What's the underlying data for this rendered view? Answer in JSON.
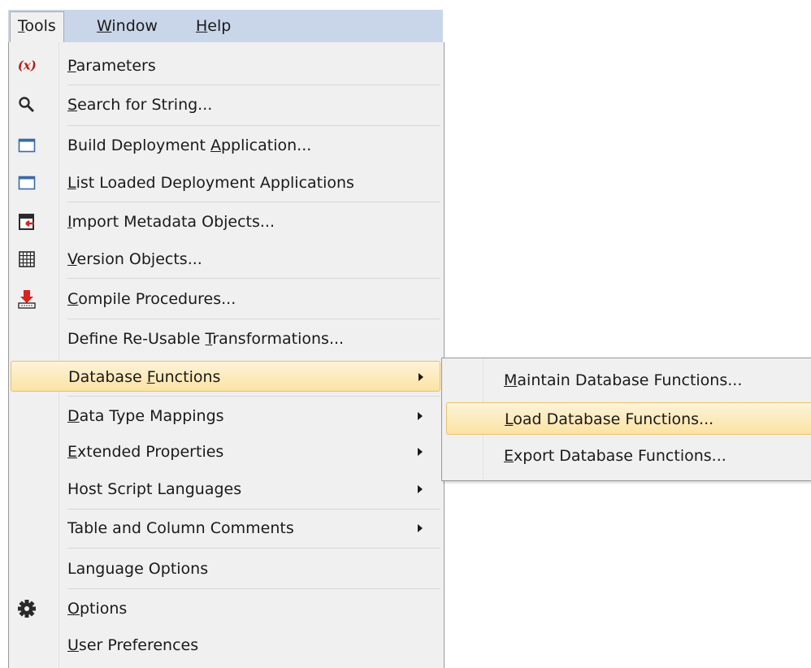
{
  "menubar": {
    "tools": "Tools",
    "window": "Window",
    "help": "Help"
  },
  "menu": {
    "items": [
      {
        "label": "Parameters",
        "icon": "parameters-x-icon"
      },
      {
        "label": "Search for String...",
        "icon": "magnifier-icon"
      },
      {
        "label": "Build Deployment Application...",
        "icon": "window-icon"
      },
      {
        "label": "List Loaded Deployment Applications",
        "icon": "window-icon"
      },
      {
        "label": "Import Metadata Objects...",
        "icon": "import-icon"
      },
      {
        "label": "Version Objects...",
        "icon": "grid-icon"
      },
      {
        "label": "Compile Procedures...",
        "icon": "compile-download-icon"
      },
      {
        "label": "Define Re-Usable Transformations...",
        "icon": ""
      },
      {
        "label": "Database Functions",
        "icon": ""
      },
      {
        "label": "Data Type Mappings",
        "icon": ""
      },
      {
        "label": "Extended Properties",
        "icon": ""
      },
      {
        "label": "Host Script Languages",
        "icon": ""
      },
      {
        "label": "Table and Column Comments",
        "icon": ""
      },
      {
        "label": "Language Options",
        "icon": ""
      },
      {
        "label": "Options",
        "icon": "gear-icon"
      },
      {
        "label": "User Preferences",
        "icon": ""
      }
    ]
  },
  "submenu": {
    "items": [
      {
        "label": "Maintain Database Functions..."
      },
      {
        "label": "Load Database Functions..."
      },
      {
        "label": "Export  Database Functions..."
      }
    ]
  },
  "colors": {
    "menubar_bg": "#c9d6ea",
    "menu_bg": "#f0f0f0",
    "highlight": "#fbe3a3",
    "highlight_border": "#e6c26c",
    "param_icon_red": "#b31d1d",
    "compile_icon_red": "#d8231f"
  }
}
